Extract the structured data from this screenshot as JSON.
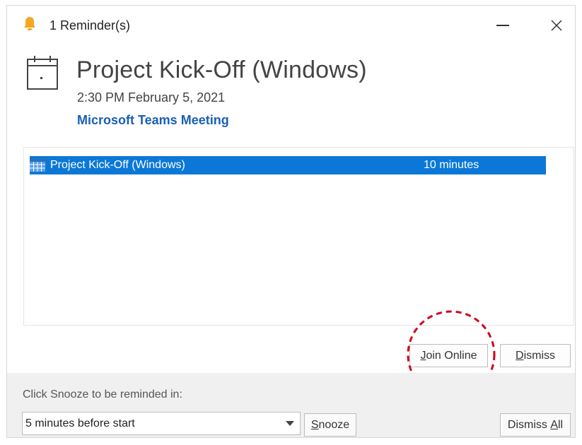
{
  "window": {
    "title": "1 Reminder(s)",
    "icons": {
      "app": "bell-icon",
      "minimize": "minimize-icon",
      "close": "close-icon"
    }
  },
  "header": {
    "icon": "calendar-icon",
    "subject": "Project Kick-Off (Windows)",
    "datetime": "2:30 PM February 5, 2021",
    "location_link": "Microsoft Teams Meeting"
  },
  "reminders": [
    {
      "icon": "calendar-grid-icon",
      "subject": "Project Kick-Off (Windows)",
      "due_in": "10 minutes",
      "selected": true
    }
  ],
  "actions": {
    "join_online": {
      "mnemonic": "J",
      "rest": "oin Online"
    },
    "dismiss": {
      "mnemonic": "D",
      "rest": "ismiss"
    }
  },
  "snooze": {
    "hint": "Click Snooze to be reminded in:",
    "selected_option": "5 minutes before start",
    "snooze_button": {
      "mnemonic": "S",
      "rest": "nooze"
    },
    "dismiss_all_button": {
      "before": "Dismiss ",
      "mnemonic": "A",
      "rest": "ll"
    }
  },
  "colors": {
    "selection": "#0b78d7",
    "link": "#1a5fb4",
    "bell": "#f5a623",
    "annotation_circle": "#d0021b",
    "footer_bg": "#f0f0f0"
  }
}
